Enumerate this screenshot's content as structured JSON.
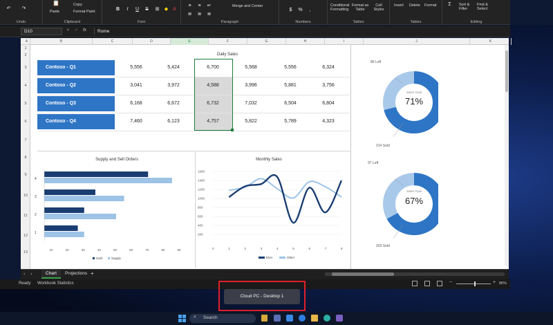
{
  "ribbon": {
    "groups": [
      "Undo",
      "Clipboard",
      "Font",
      "Paragraph",
      "Numbers",
      "Tables",
      "Tables",
      "Editing"
    ],
    "clipboard": {
      "paste": "Paste",
      "copy": "Copy",
      "format_paint": "Format Paint"
    },
    "font": {
      "bold": "B",
      "italic": "I",
      "underline": "U",
      "strike": "S"
    },
    "paragraph": {
      "merge": "Merge and Center"
    },
    "numbers": {
      "currency": "$",
      "percent": "%",
      "comma": ","
    },
    "tables": {
      "cond": "Conditional Formatting",
      "format_table": "Format as Table",
      "cell_styles": "Cell Styles"
    },
    "cells": {
      "insert": "Insert",
      "delete": "Delete",
      "format": "Format"
    },
    "editing": {
      "sort": "Sort & Filter",
      "find": "Find & Select"
    }
  },
  "formula_bar": {
    "name_box": "D10",
    "fx": "fx",
    "value": "Rome"
  },
  "columns": [
    "A",
    "B",
    "C",
    "D",
    "E",
    "F",
    "G",
    "H",
    "I",
    "J",
    "K"
  ],
  "rows": [
    "1",
    "2",
    "3",
    "4",
    "5",
    "6",
    "7",
    "8",
    "9",
    "10",
    "11",
    "12",
    "13"
  ],
  "daily_sales": {
    "title": "Daily Sales",
    "rows": [
      {
        "label": "Contoso - Q1",
        "values": [
          "5,556",
          "5,424",
          "6,700",
          "5,568",
          "5,556",
          "6,324"
        ]
      },
      {
        "label": "Contoso - Q2",
        "values": [
          "3,041",
          "3,972",
          "4,588",
          "3,996",
          "5,881",
          "3,756"
        ]
      },
      {
        "label": "Contoso - Q3",
        "values": [
          "6,168",
          "6,672",
          "6,732",
          "7,032",
          "6,504",
          "6,804"
        ]
      },
      {
        "label": "Contoso - Q4",
        "values": [
          "7,460",
          "6,123",
          "4,757",
          "5,822",
          "5,789",
          "4,323"
        ]
      }
    ]
  },
  "donut1": {
    "left": "86 Left",
    "center_label": "Sales Goal",
    "percent": "71%",
    "sold": "214 Sold",
    "fraction": 0.71
  },
  "donut2": {
    "left": "97 Left",
    "center_label": "Sales Goal",
    "percent": "67%",
    "sold": "203 Sold",
    "fraction": 0.67
  },
  "chart_data": [
    {
      "type": "bar",
      "title": "Supply and Sell Orders",
      "categories": [
        "4",
        "3",
        "2",
        "1"
      ],
      "series": [
        {
          "name": "Sold",
          "values": [
            70,
            37,
            30,
            26
          ]
        },
        {
          "name": "Supply",
          "values": [
            85,
            55,
            50,
            30
          ]
        }
      ],
      "xticks": [
        "10",
        "20",
        "30",
        "40",
        "50",
        "60",
        "70",
        "80",
        "90"
      ],
      "xlim": [
        5,
        95
      ],
      "colors": [
        "#1a3e72",
        "#9dc3e6"
      ]
    },
    {
      "type": "line",
      "title": "Monthly Sales",
      "x": [
        1,
        2,
        3,
        4,
        5,
        6,
        7,
        8
      ],
      "yticks": [
        "1600",
        "1400",
        "1200",
        "1000",
        "800",
        "600",
        "400",
        "200"
      ],
      "xticks": [
        "0",
        "1",
        "2",
        "3",
        "4",
        "5",
        "6",
        "7",
        "8"
      ],
      "ylim": [
        0,
        1600
      ],
      "series": [
        {
          "name": "Elon",
          "values": [
            1030,
            1270,
            1320,
            1480,
            460,
            1240,
            690,
            1400
          ]
        },
        {
          "name": "Other",
          "values": [
            1180,
            1250,
            1440,
            1220,
            1010,
            1370,
            1260,
            1030
          ]
        }
      ],
      "colors": [
        "#1a3e72",
        "#9dc3e6"
      ]
    }
  ],
  "sheet_tabs": {
    "active": "Chart",
    "other": "Projections",
    "add": "+"
  },
  "status": {
    "ready": "Ready",
    "stats": "Workbook Statistics",
    "zoom": "86%"
  },
  "popup": {
    "label": "Cloud PC - Desktop 1"
  },
  "taskbar": {
    "search": "Search"
  }
}
